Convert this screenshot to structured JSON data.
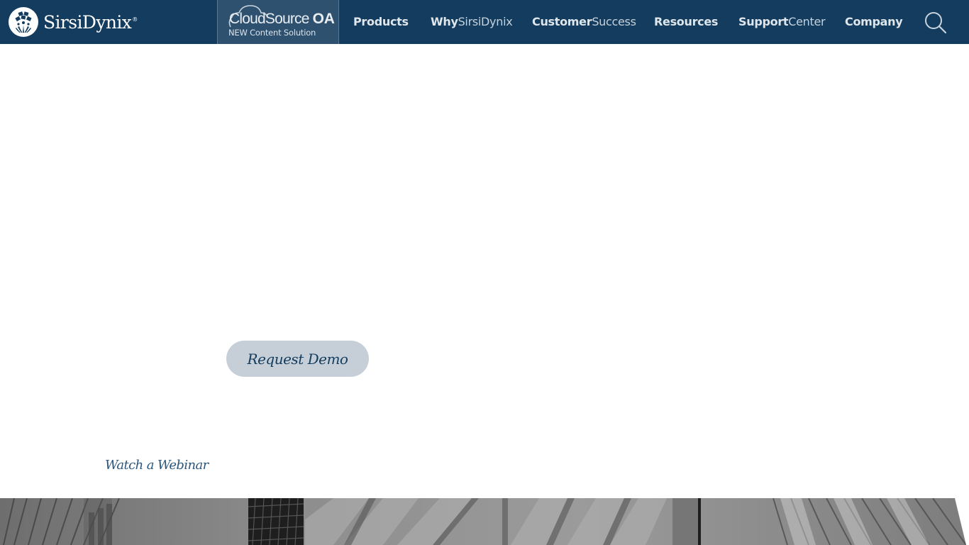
{
  "header": {
    "logo": {
      "name": "SirsiDynix",
      "registered_mark": "®"
    },
    "featured_tab": {
      "title_light": "CloudSource",
      "title_bold": "OA",
      "subtitle": "NEW Content Solution"
    },
    "nav_items": [
      {
        "strong": "Products",
        "light": ""
      },
      {
        "strong": "Why",
        "light": "SirsiDynix"
      },
      {
        "strong": "Customer",
        "light": "Success"
      },
      {
        "strong": "Resources",
        "light": ""
      },
      {
        "strong": "Support",
        "light": "Center"
      },
      {
        "strong": "Company",
        "light": ""
      }
    ],
    "search_icon": "search-icon"
  },
  "main": {
    "request_demo_label": "Request Demo",
    "watch_webinar_label": "Watch a Webinar"
  },
  "hero_image": {
    "description": "Black and white architectural stone building facade"
  },
  "colors": {
    "nav_background": "#133c5e",
    "featured_tab_background": "#2f5170",
    "button_background": "#c6cfd8",
    "button_text": "#133c5e",
    "link_text": "#2b577d"
  }
}
